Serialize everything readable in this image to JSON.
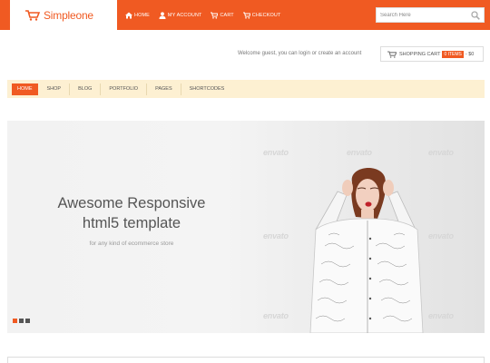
{
  "brand": {
    "name_part1": "Simple",
    "name_part2": "one",
    "accent": "#f05a22"
  },
  "top_nav": [
    {
      "label": "HOME",
      "icon": "home-icon"
    },
    {
      "label": "MY ACCOUNT",
      "icon": "user-icon"
    },
    {
      "label": "CART",
      "icon": "cart-icon"
    },
    {
      "label": "CHECKOUT",
      "icon": "cart-check-icon"
    }
  ],
  "search": {
    "placeholder": "Search Here",
    "icon": "search-icon"
  },
  "welcome_text": "Welcome guest, you can login or create an account",
  "cart": {
    "label": "SHOPPING CART",
    "count": "0 ITEMS",
    "total": "- $0"
  },
  "main_nav": [
    {
      "label": "HOME",
      "active": true
    },
    {
      "label": "SHOP"
    },
    {
      "label": "BLOG"
    },
    {
      "label": "PORTFOLIO"
    },
    {
      "label": "PAGES"
    },
    {
      "label": "SHORTCODES"
    }
  ],
  "slide": {
    "title_line1": "Awesome Responsive",
    "title_line2": "html5 template",
    "subtitle": "for any kind of ecommerce store",
    "watermark": "envato",
    "dots": 3,
    "active_dot": 1
  }
}
